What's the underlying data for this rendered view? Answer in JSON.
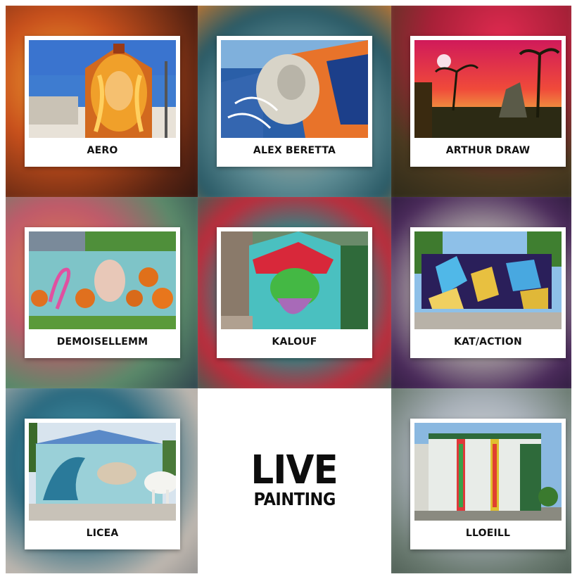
{
  "artists": [
    {
      "name": "AERO"
    },
    {
      "name": "ALEX BERETTA"
    },
    {
      "name": "ARTHUR DRAW"
    },
    {
      "name": "DEMOISELLEMM"
    },
    {
      "name": "KALOUF"
    },
    {
      "name": "KAT/ACTION"
    },
    {
      "name": "LICEA"
    },
    {
      "name": "LLOEILL"
    }
  ],
  "logo": {
    "line1": "LIVE",
    "line2": "PAINTING"
  }
}
